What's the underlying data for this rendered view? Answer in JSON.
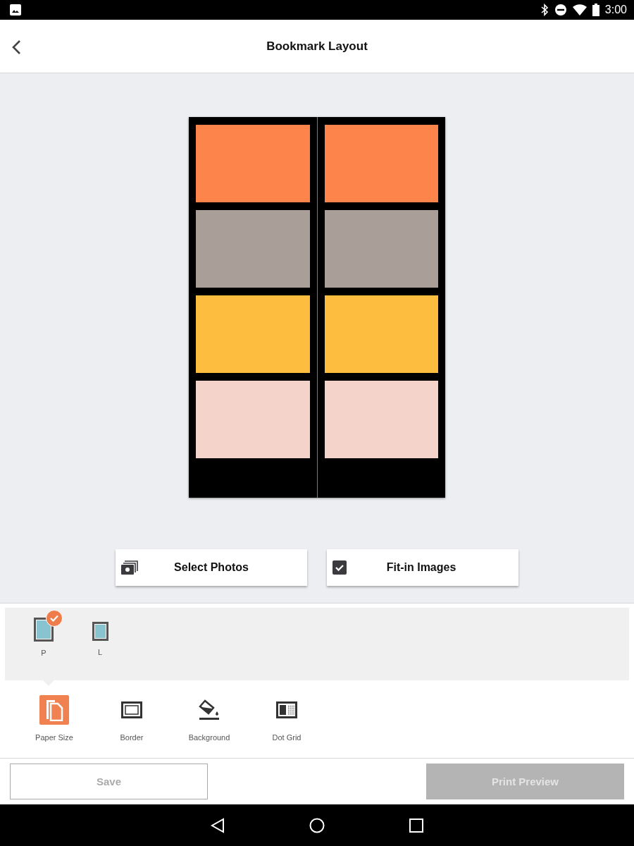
{
  "status_bar": {
    "time": "3:00"
  },
  "header": {
    "title": "Bookmark Layout"
  },
  "preview": {
    "columns": [
      {
        "slots": [
          {
            "color": "#fd844b"
          },
          {
            "color": "#aa9e99"
          },
          {
            "color": "#fdbd3e"
          },
          {
            "color": "#f4d3cb"
          }
        ]
      },
      {
        "slots": [
          {
            "color": "#fd844b"
          },
          {
            "color": "#aa9e99"
          },
          {
            "color": "#fdbd3e"
          },
          {
            "color": "#f4d3cb"
          }
        ]
      }
    ]
  },
  "actions": [
    {
      "kind": "photos",
      "label": "Select Photos"
    },
    {
      "kind": "checkbox",
      "label": "Fit-in Images",
      "checked": true
    }
  ],
  "orientations": [
    {
      "label": "P",
      "kind": "portrait",
      "selected": true
    },
    {
      "label": "L",
      "kind": "landscape",
      "selected": false
    }
  ],
  "tools": [
    {
      "kind": "paper",
      "label": "Paper Size",
      "selected": true
    },
    {
      "kind": "border",
      "label": "Border",
      "selected": false
    },
    {
      "kind": "background",
      "label": "Background",
      "selected": false
    },
    {
      "kind": "dotgrid",
      "label": "Dot Grid",
      "selected": false
    }
  ],
  "footer": [
    {
      "kind": "outline",
      "label": "Save",
      "disabled": true
    },
    {
      "kind": "filled",
      "label": "Print Preview",
      "disabled": true
    }
  ]
}
